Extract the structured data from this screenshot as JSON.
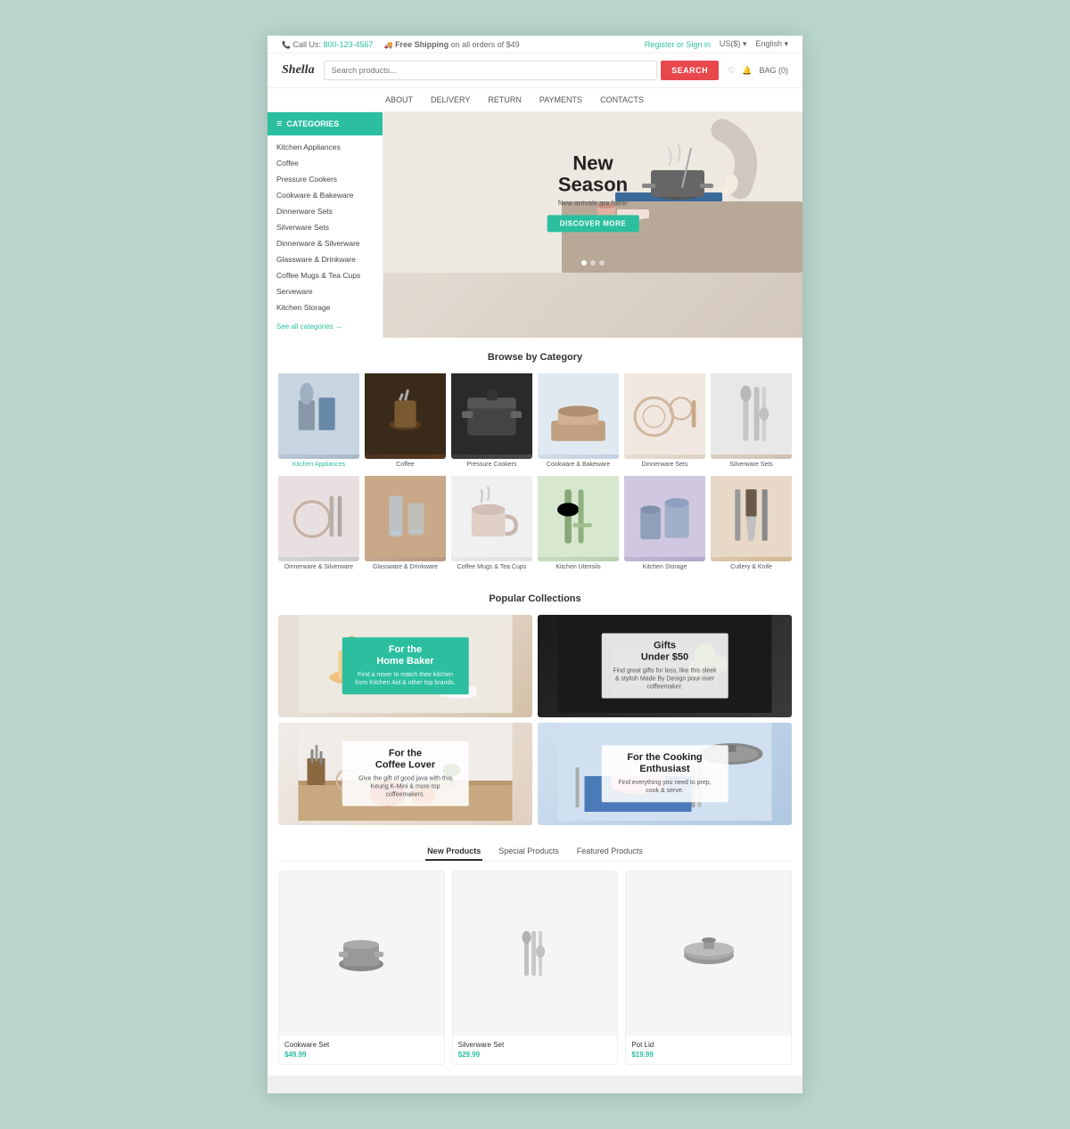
{
  "topbar": {
    "phone_label": "Call Us:",
    "phone_number": "800-123-4567",
    "shipping_label": "Free Shipping",
    "shipping_sub": "on all orders of $49",
    "register_link": "Register or Sign in",
    "currency": "US($) ▾",
    "language": "English ▾"
  },
  "header": {
    "logo": "Shella",
    "search_placeholder": "Search products...",
    "search_btn": "SEARCH",
    "wishlist": "♡",
    "notify": "🔔",
    "cart": "BAG (0)"
  },
  "nav": {
    "items": [
      "ABOUT",
      "DELIVERY",
      "RETURN",
      "PAYMENTS",
      "CONTACTS"
    ]
  },
  "sidebar": {
    "categories_label": "CATEGORIES",
    "items": [
      "Kitchen Appliances",
      "Coffee",
      "Pressure Cookers",
      "Cookware & Bakeware",
      "Dinnerware Sets",
      "Silverware Sets",
      "Dinnerware & Silverware",
      "Glassware & Drinkware",
      "Coffee Mugs & Tea Cups",
      "Serveware",
      "Kitchen Storage"
    ],
    "see_all": "See all categories →"
  },
  "hero": {
    "title_line1": "New",
    "title_line2": "Season",
    "subtitle": "New arrivals are here!",
    "btn_label": "DISCOVER MORE"
  },
  "browse": {
    "section_title": "Browse by Category",
    "categories": [
      {
        "label": "Kitchen Appliances",
        "active": true
      },
      {
        "label": "Coffee",
        "active": false
      },
      {
        "label": "Pressure Cookers",
        "active": false
      },
      {
        "label": "Cookware & Bakeware",
        "active": false
      },
      {
        "label": "Dinnerware Sets",
        "active": false
      },
      {
        "label": "Silverware Sets",
        "active": false
      },
      {
        "label": "Dinnerware & Silverware",
        "active": false
      },
      {
        "label": "Glassware & Drinkware",
        "active": false
      },
      {
        "label": "Coffee Mugs & Tea Cups",
        "active": false
      },
      {
        "label": "Kitchen Utensils",
        "active": false
      },
      {
        "label": "Kitchen Storage",
        "active": false
      },
      {
        "label": "Cutlery & Knife",
        "active": false
      }
    ]
  },
  "collections": {
    "section_title": "Popular Collections",
    "items": [
      {
        "title": "For the Home Baker",
        "description": "Find a mixer to match their kitchen from Kitchen Aid & other top brands.",
        "overlay_style": "teal"
      },
      {
        "title": "Gifts Under $50",
        "description": "Find great gifts for less, like this sleek & stylish Made By Design pour-over coffeemaker.",
        "overlay_style": "white"
      },
      {
        "title": "For the Coffee Lover",
        "description": "Give the gift of good java with this Keurig K-Mini & more top coffeemakers.",
        "overlay_style": "white"
      },
      {
        "title": "For the Cooking Enthusiast",
        "description": "Find everything you need to prep, cook & serve.",
        "overlay_style": "white"
      }
    ]
  },
  "products": {
    "tabs": [
      "New Products",
      "Special Products",
      "Featured Products"
    ],
    "active_tab": 0,
    "items": [
      {
        "name": "Cookware Set",
        "price": "$49.99"
      },
      {
        "name": "Silverware Set",
        "price": "$29.99"
      },
      {
        "name": "Pot Lid",
        "price": "$19.99"
      }
    ]
  }
}
